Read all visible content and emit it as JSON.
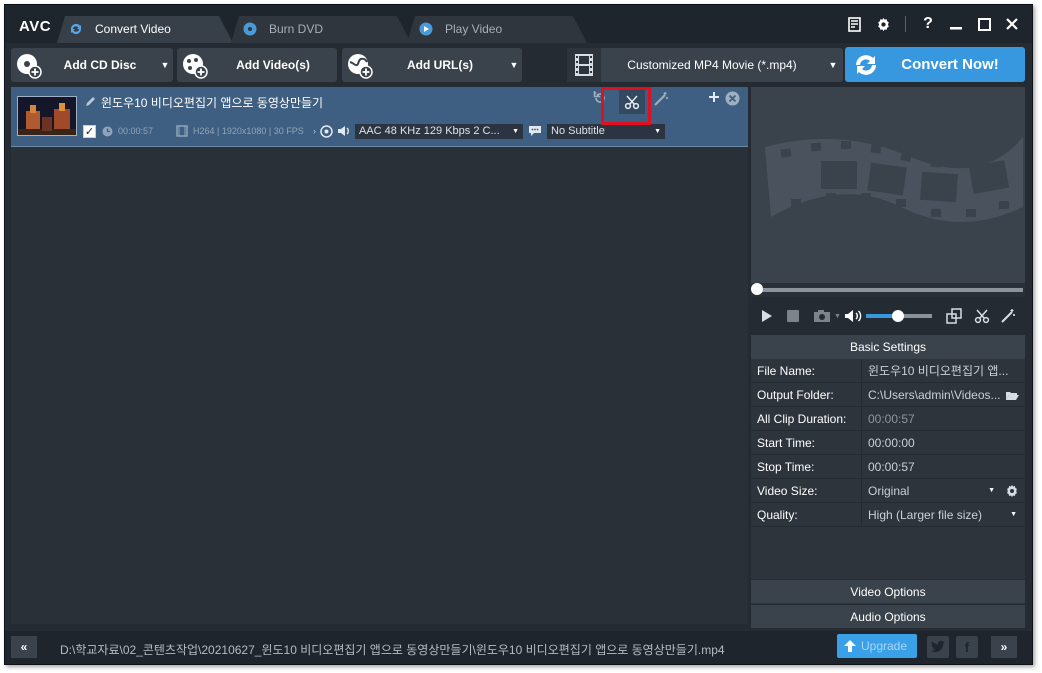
{
  "app": {
    "logo": "AVC"
  },
  "tabs": [
    {
      "label": "Convert Video",
      "active": true
    },
    {
      "label": "Burn DVD",
      "active": false
    },
    {
      "label": "Play Video",
      "active": false
    }
  ],
  "toolbar": {
    "add_cd_label": "Add CD Disc",
    "add_videos_label": "Add Video(s)",
    "add_url_label": "Add URL(s)",
    "profile_label": "Customized MP4 Movie (*.mp4)",
    "convert_label": "Convert Now!"
  },
  "file": {
    "name": "윈도우10 비디오편집기 앱으로 동영상만들기",
    "duration": "00:00:57",
    "video_info": "H264 | 1920x1080 | 30 FPS",
    "audio": "AAC 48 KHz 129 Kbps 2 C...",
    "subtitle": "No Subtitle",
    "checked": true
  },
  "settings": {
    "header": "Basic Settings",
    "rows": [
      {
        "key": "File Name:",
        "value": "윈도우10 비디오편집기 앱..."
      },
      {
        "key": "Output Folder:",
        "value": "C:\\Users\\admin\\Videos..."
      },
      {
        "key": "All Clip Duration:",
        "value": "00:00:57"
      },
      {
        "key": "Start Time:",
        "value": "00:00:00"
      },
      {
        "key": "Stop Time:",
        "value": "00:00:57"
      },
      {
        "key": "Video Size:",
        "value": "Original"
      },
      {
        "key": "Quality:",
        "value": "High (Larger file size)"
      }
    ],
    "video_options": "Video Options",
    "audio_options": "Audio Options"
  },
  "status": {
    "path": "D:\\학교자료\\02_콘텐츠작업\\20210627_윈도10 비디오편집기 앱으로 동영상만들기\\윈도우10 비디오편집기 앱으로 동영상만들기.mp4",
    "upgrade_label": "Upgrade"
  },
  "colors": {
    "accent": "#3798e0",
    "highlight": "#e01020",
    "selected_row": "#3f5f82"
  }
}
